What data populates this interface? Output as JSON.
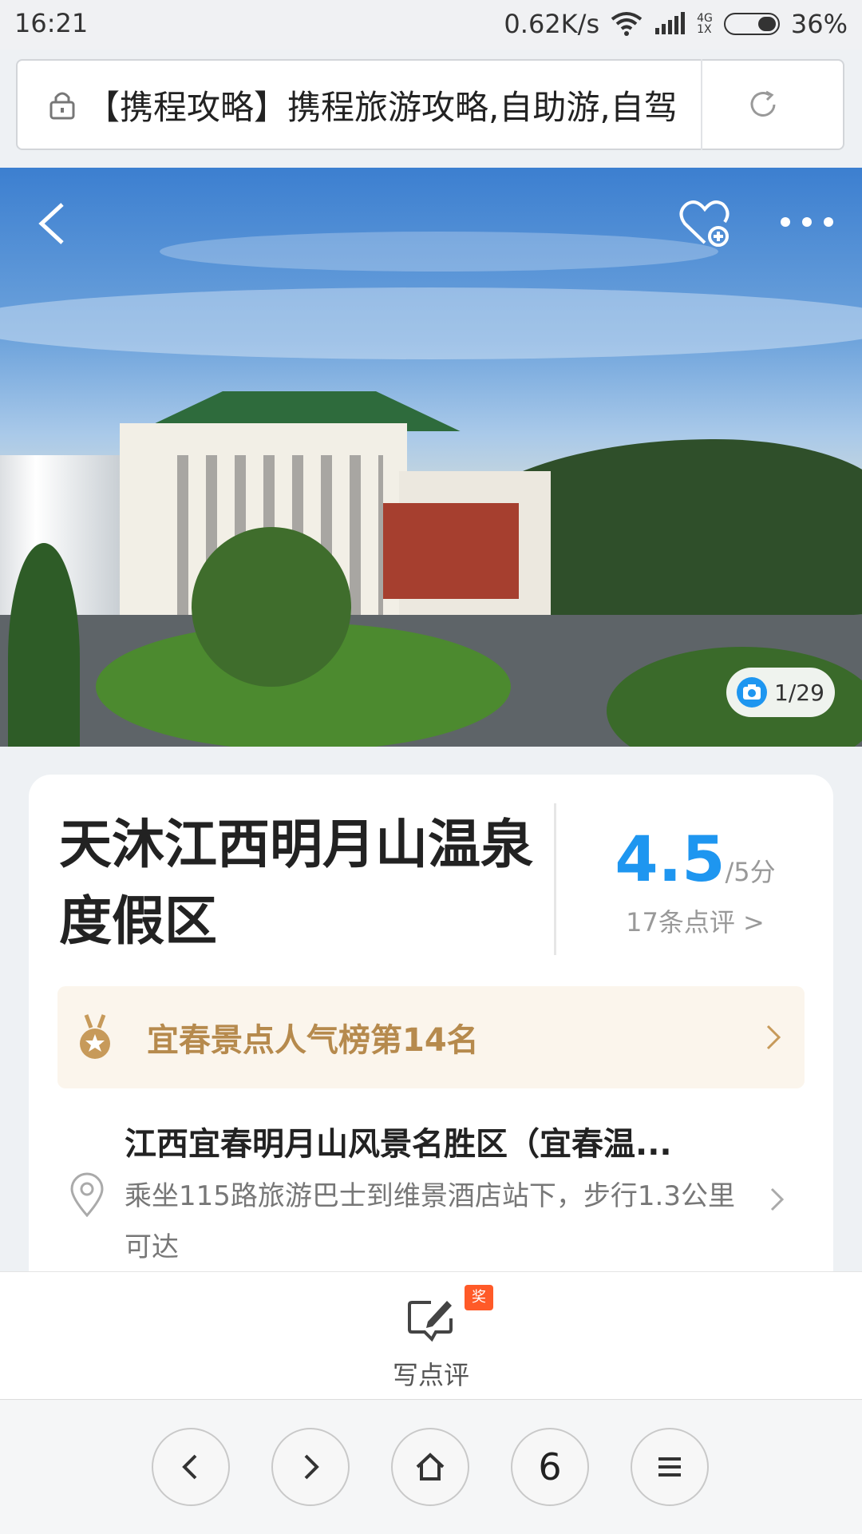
{
  "status_bar": {
    "time": "16:21",
    "net_speed": "0.62K/s",
    "network_type": "4G",
    "network_sub": "1X",
    "battery": "36%"
  },
  "browser": {
    "url_title": "【携程攻略】携程旅游攻略,自助游,自驾",
    "lock_icon": "lock-icon",
    "reload_icon": "reload-icon"
  },
  "hero": {
    "photo_counter": "1/29",
    "icons": [
      "back-arrow-icon",
      "favorite-add-icon",
      "more-icon",
      "camera-icon"
    ]
  },
  "attraction": {
    "title": "天沐江西明月山温泉度假区",
    "score": "4.5",
    "score_unit": "/5分",
    "review_link": "17条点评 >",
    "rank_text": "宜春景点人气榜第14名",
    "location_name": "江西宜春明月山风景名胜区（宜春温...",
    "location_desc": "乘坐115路旅游巴士到维景酒店站下，步行1.3公里可达"
  },
  "bottom_action": {
    "write_review_label": "写点评",
    "award_badge": "奖"
  },
  "browser_nav": {
    "tab_count": "6"
  },
  "colors": {
    "accent_blue": "#1e96f0",
    "rank_gold": "#b68a4d",
    "badge_orange": "#ff5a28"
  }
}
